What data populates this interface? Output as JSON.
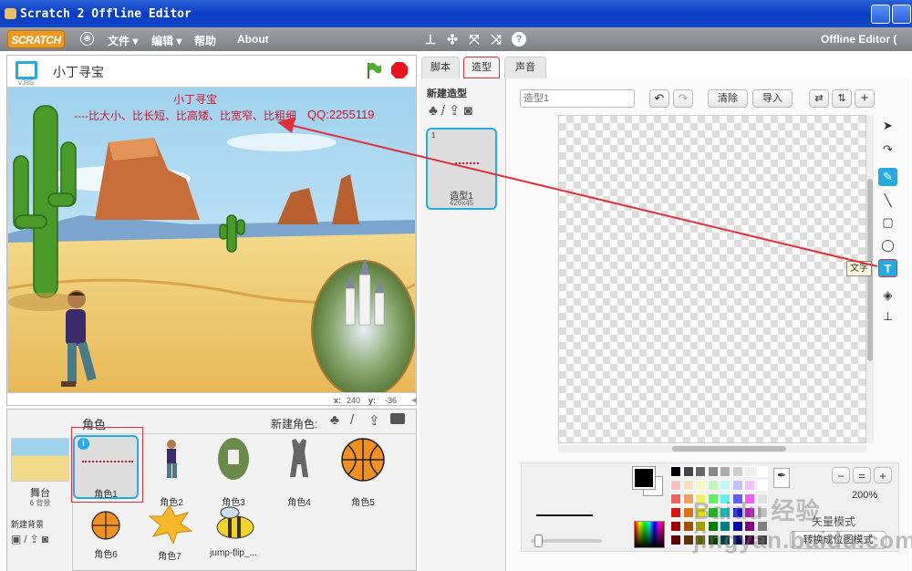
{
  "window": {
    "title": "Scratch 2 Offline Editor"
  },
  "menu": {
    "logo": "SCRATCH",
    "file": "文件 ▾",
    "edit": "编辑 ▾",
    "help": "帮助",
    "about": "About",
    "right_label": "Offline Editor ("
  },
  "stage": {
    "project_name": "小丁寻宝",
    "version": "v385",
    "text_line1": "小丁寻宝",
    "text_line2": "----比大小、比长短、比高矮、比宽窄、比粗细",
    "text_qq": "QQ:2255119",
    "coords_x_label": "x:",
    "coords_x": "240",
    "coords_y_label": "y:",
    "coords_y": "-36"
  },
  "sprites_panel": {
    "header": "角色",
    "new_sprite_label": "新建角色:",
    "stage_name": "舞台",
    "stage_backdrops": "6 背景",
    "new_backdrop_label": "新建背景",
    "items": [
      {
        "name": "角色1"
      },
      {
        "name": "角色2"
      },
      {
        "name": "角色3"
      },
      {
        "name": "角色4"
      },
      {
        "name": "角色5"
      },
      {
        "name": "角色6"
      },
      {
        "name": "角色7"
      },
      {
        "name": "jump-flip_..."
      }
    ]
  },
  "tabs": {
    "scripts": "脚本",
    "costumes": "造型",
    "sounds": "声音"
  },
  "costumes_panel": {
    "new_costume_label": "新建造型",
    "costume_index": "1",
    "costume_name": "造型1",
    "costume_size": "426x45"
  },
  "editor": {
    "name_placeholder": "造型1",
    "clear_label": "清除",
    "import_label": "导入",
    "text_tool_tooltip": "文字",
    "zoom_level": "200%",
    "vector_mode_label": "矢量模式",
    "convert_label": "转换成位图模式"
  },
  "colors": {
    "title_bar": "#0a3cc4",
    "menu_bar": "#8b8f93",
    "accent": "#25aae1",
    "stage_text": "#d4142a",
    "arrow": "#e0303a"
  },
  "watermark": "Baidu 经验 jingyan.baidu.com"
}
